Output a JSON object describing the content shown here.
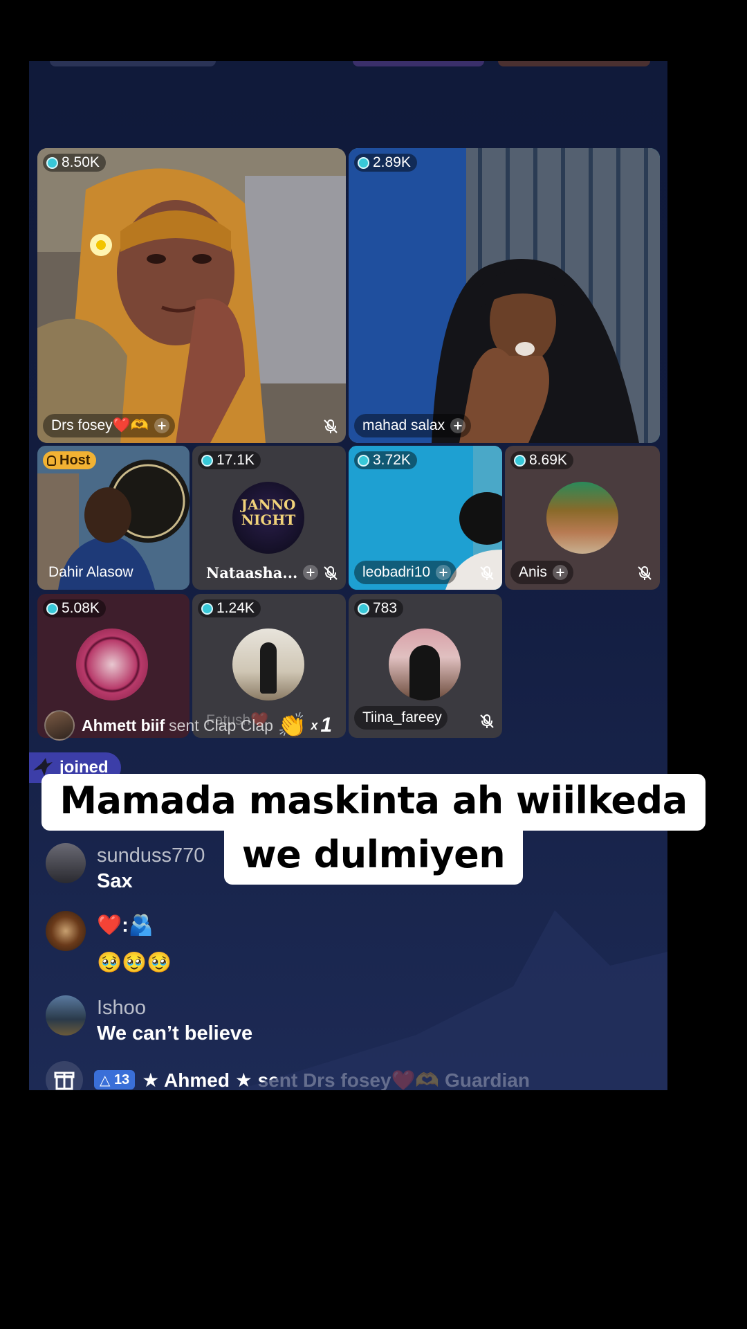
{
  "stage": {
    "featured": [
      {
        "count": "8.50K",
        "name": "Drs fosey❤️🫶",
        "muted": true
      },
      {
        "count": "2.89K",
        "name": "mahad salax",
        "muted": false
      }
    ],
    "grid": [
      {
        "host_label": "Host",
        "name": "Dahir Alasow"
      },
      {
        "count": "17.1K",
        "name": "Nataasha...",
        "muted": true,
        "avatar_text_top": "JANNO",
        "avatar_text_bottom": "NIGHT"
      },
      {
        "count": "3.72K",
        "name": "leobadri10",
        "muted": true
      },
      {
        "count": "8.69K",
        "name": "Anis",
        "muted": true
      },
      {
        "count": "5.08K",
        "name": ""
      },
      {
        "count": "1.24K",
        "name": "Fatush❤️"
      },
      {
        "count": "783",
        "name": "Tiina_fareey",
        "muted": true
      }
    ]
  },
  "gift_banner": {
    "sender": "Ahmett biif",
    "action": "sent Clap Clap",
    "emoji": "👏",
    "multiplier": "x",
    "number": "1"
  },
  "joined": {
    "text": "joined"
  },
  "ghost_pill": "M",
  "comments": [
    {
      "user": "sunduss770",
      "text": "Sax"
    },
    {
      "user": "",
      "text": "❤️:🫂",
      "text2": "🥹🥹🥹"
    },
    {
      "user": "Ishoo",
      "text": "We can’t believe"
    }
  ],
  "caption": {
    "line1": "Mamada maskinta ah wiilkeda",
    "line2": "we dulmiyen"
  },
  "bottom_gift": {
    "level": "13",
    "text": "★ Ahmed ★ sent Drs fosey❤️🫶 Guardian"
  },
  "colors": {
    "active_border": "#23b4c9",
    "host_badge": "#f2b233",
    "joined_bg": "#3c3ea8",
    "coin": "#38c8d8"
  }
}
